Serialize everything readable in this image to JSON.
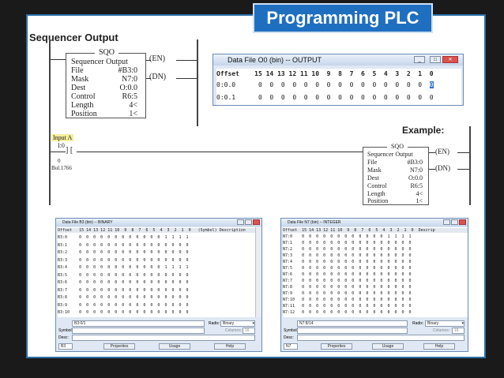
{
  "slide_title": "Programming PLC",
  "section_label": "Sequencer Output",
  "example_label": "Example:",
  "sqo_top": {
    "header": "SQO",
    "title": "Sequencer Output",
    "rows": [
      [
        "File",
        "#B3:0"
      ],
      [
        "Mask",
        "N7:0"
      ],
      [
        "Dest",
        "O:0.0"
      ],
      [
        "Control",
        "R6:5"
      ],
      [
        "Length",
        "4<"
      ],
      [
        "Position",
        "1<"
      ]
    ],
    "coil_en": "EN",
    "coil_dn": "DN"
  },
  "sqo_bottom": {
    "header": "SQO",
    "title": "Sequencer Output",
    "rows": [
      [
        "File",
        "#B3:0"
      ],
      [
        "Mask",
        "N7:0"
      ],
      [
        "Dest",
        "O:0.0"
      ],
      [
        "Control",
        "R6:5"
      ],
      [
        "Length",
        "4<"
      ],
      [
        "Position",
        "1<"
      ]
    ],
    "coil_en": "EN",
    "coil_dn": "DN"
  },
  "input": {
    "label": "Input A",
    "addr": "I:0",
    "bit": "0",
    "module": "Bul.1766"
  },
  "output_window": {
    "title": "Data File O0 (bin)  --  OUTPUT",
    "header": "Offset    15 14 13 12 11 10  9  8  7  6  5  4  3  2  1  0",
    "rows": [
      "0:0.0      0  0  0  0  0  0  0  0  0  0  0  0  0  0  0  ",
      "0:0.1      0  0  0  0  0  0  0  0  0  0  0  0  0  0  0  0"
    ],
    "selected_value": "0"
  },
  "binary_window": {
    "title": "Data File B3 (bin)  --  BINARY",
    "header": "Offset   15 14 13 12 11 10  9  8  7  6  5  4  3  2  1  0   (Symbol) Description",
    "rows": [
      "B3:0     0  0  0  0  0  0  0  0  0  0  0  0  1  1  1  1",
      "B3:1     0  0  0  0  0  0  0  0  0  0  0  0  0  0  0  0",
      "B3:2     0  0  0  0  0  0  0  0  0  0  0  0  0  0  0  0",
      "B3:3     0  0  0  0  0  0  0  0  0  0  0  0  0  0  0  0",
      "B3:4     0  0  0  0  0  0  0  0  0  0  0  0  1  1  1  1",
      "B3:5     0  0  0  0  0  0  0  0  0  0  0  0  0  0  0  0",
      "B3:6     0  0  0  0  0  0  0  0  0  0  0  0  0  0  0  0",
      "B3:7     0  0  0  0  0  0  0  0  0  0  0  0  0  0  0  0",
      "B3:8     0  0  0  0  0  0  0  0  0  0  0  0  0  0  0  0",
      "B3:9     0  0  0  0  0  0  0  0  0  0  0  0  0  0  0  0",
      "B3:10    0  0  0  0  0  0  0  0  0  0  0  0  0  0  0  0"
    ],
    "addr_field": "B3:0/1",
    "radix_label": "Radix:",
    "radix_value": "Binary",
    "symbol_label": "Symbol:",
    "columns_label": "Columns:",
    "columns_value": "16",
    "desc_label": "Desc:",
    "file_field": "B3",
    "buttons": [
      "Properties",
      "Usage",
      "Help"
    ]
  },
  "integer_window": {
    "title": "Data File N7 (bin)  --  INTEGER",
    "header": "Offset  15 14 13 12 11 10  9  8  7  6  5  4  3  2  1  0  Descrip",
    "rows": [
      "N7:0    0  0  0  0  0  0  0  0  0  0  0  0  1  1  1  1",
      "N7:1    0  0  0  0  0  0  0  0  0  0  0  0  0  0  0  0",
      "N7:2    0  0  0  0  0  0  0  0  0  0  0  0  0  0  0  0",
      "N7:3    0  0  0  0  0  0  0  0  0  0  0  0  0  0  0  0",
      "N7:4    0  0  0  0  0  0  0  0  0  0  0  0  0  0  0  0",
      "N7:5    0  0  0  0  0  0  0  0  0  0  0  0  0  0  0  0",
      "N7:6    0  0  0  0  0  0  0  0  0  0  0  0  0  0  0  0",
      "N7:7    0  0  0  0  0  0  0  0  0  0  0  0  0  0  0  0",
      "N7:8    0  0  0  0  0  0  0  0  0  0  0  0  0  0  0  0",
      "N7:9    0  0  0  0  0  0  0  0  0  0  0  0  0  0  0  0",
      "N7:10   0  0  0  0  0  0  0  0  0  0  0  0  0  0  0  0",
      "N7:11   0  0  0  0  0  0  0  0  0  0  0  0  0  0  0  0",
      "N7:12   0  0  0  0  0  0  0  0  0  0  0  0  0  0  0  0"
    ],
    "addr_field": "N7:8/14",
    "radix_label": "Radix:",
    "radix_value": "Binary",
    "symbol_label": "Symbol:",
    "columns_label": "Columns:",
    "columns_value": "16",
    "desc_label": "Desc:",
    "file_field": "N7",
    "buttons": [
      "Properties",
      "Usage",
      "Help"
    ]
  }
}
